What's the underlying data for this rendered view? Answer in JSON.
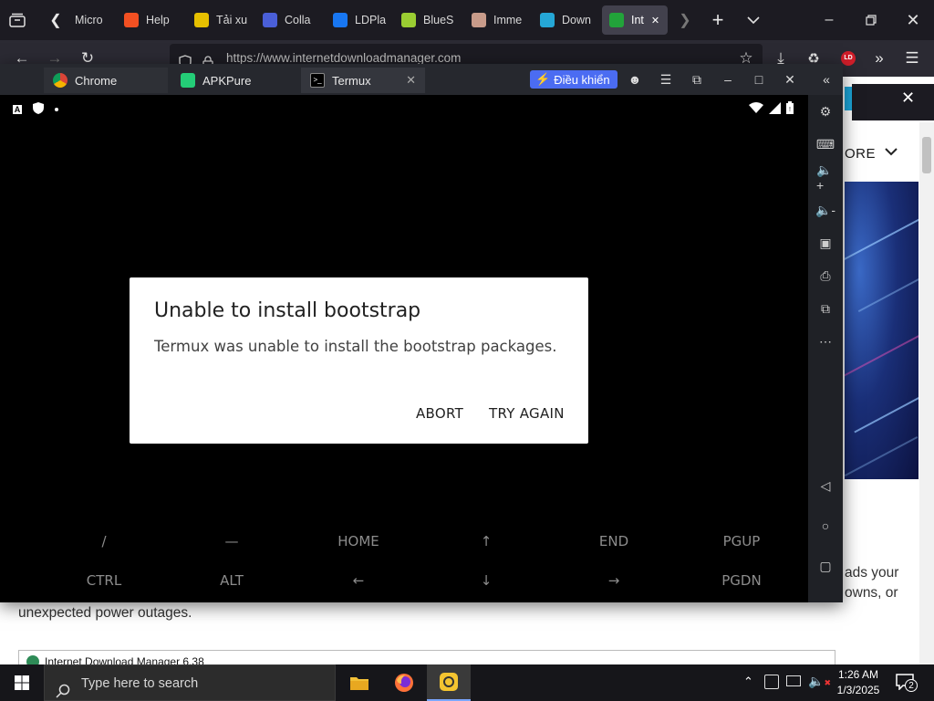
{
  "browser": {
    "tabs": [
      {
        "label": "Micro",
        "color": "#3a3a3a"
      },
      {
        "label": "Help",
        "color": "#f25022"
      },
      {
        "label": "Tải xu",
        "color": "#e6c000"
      },
      {
        "label": "Colla",
        "color": "#4a5fd8"
      },
      {
        "label": "LDPla",
        "color": "#1877f2"
      },
      {
        "label": "BlueS",
        "color": "#9acd32"
      },
      {
        "label": "Imme",
        "color": "#c89b8a"
      },
      {
        "label": "Down",
        "color": "#25a7d6"
      },
      {
        "label": "Int",
        "color": "#22a33a"
      }
    ],
    "url": "https://www.internetdownloadmanager.com",
    "extension_badge": "LD"
  },
  "emulator": {
    "tabs": [
      {
        "label": "Chrome"
      },
      {
        "label": "APKPure"
      },
      {
        "label": "Termux"
      }
    ],
    "control_button": "Điều khiển"
  },
  "android": {
    "dialog": {
      "title": "Unable to install bootstrap",
      "message": "Termux was unable to install the bootstrap packages.",
      "abort": "ABORT",
      "try_again": "TRY AGAIN"
    },
    "extra_keys_row1": [
      "/",
      "—",
      "HOME",
      "↑",
      "END",
      "PGUP"
    ],
    "extra_keys_row2": [
      "CTRL",
      "ALT",
      "←",
      "↓",
      "→",
      "PGDN"
    ]
  },
  "site": {
    "more_label": "ORE",
    "text_line1": "ads your",
    "text_line2": "owns, or",
    "text_line3": "unexpected power outages.",
    "idm_window_title": "Internet Download Manager 6.38"
  },
  "taskbar": {
    "search_placeholder": "Type here to search",
    "time": "1:26 AM",
    "date": "1/3/2025",
    "notification_count": "2"
  }
}
